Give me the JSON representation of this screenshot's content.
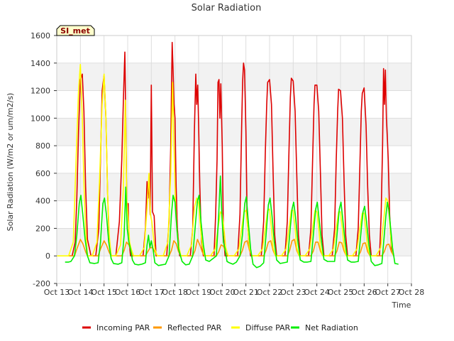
{
  "chart_data": {
    "type": "line",
    "title": "Solar Radiation",
    "xlabel": "Time",
    "ylabel": "Solar Radiation (W/m2 or um/m2/s)",
    "site_label": "SI_met",
    "xlim": [
      13,
      28
    ],
    "ylim": [
      -200,
      1600
    ],
    "x_ticks": [
      13,
      14,
      15,
      16,
      17,
      18,
      19,
      20,
      21,
      22,
      23,
      24,
      25,
      26,
      27,
      28
    ],
    "x_tick_labels": [
      "Oct 13",
      "Oct 14",
      "Oct 15",
      "Oct 16",
      "Oct 17",
      "Oct 18",
      "Oct 19",
      "Oct 20",
      "Oct 21",
      "Oct 22",
      "Oct 23",
      "Oct 24",
      "Oct 25",
      "Oct 26",
      "Oct 27",
      "Oct 28"
    ],
    "y_ticks": [
      -200,
      0,
      200,
      400,
      600,
      800,
      1000,
      1200,
      1400,
      1600
    ],
    "grid": true,
    "legend_position": "bottom",
    "series": [
      {
        "name": "Incoming PAR",
        "color": "#dd0000",
        "x": [
          13.5,
          13.65,
          13.78,
          13.85,
          13.92,
          14.0,
          14.08,
          14.15,
          14.22,
          14.3,
          14.45,
          14.5,
          14.65,
          14.78,
          14.85,
          14.92,
          15.0,
          15.08,
          15.15,
          15.22,
          15.3,
          15.45,
          15.5,
          15.65,
          15.75,
          15.82,
          15.88,
          15.92,
          15.96,
          16.02,
          16.06,
          16.12,
          16.2,
          16.45,
          16.5,
          16.65,
          16.75,
          16.82,
          16.86,
          16.9,
          16.95,
          17.0,
          17.05,
          17.12,
          17.2,
          17.45,
          17.5,
          17.65,
          17.75,
          17.82,
          17.88,
          17.92,
          17.96,
          18.0,
          18.05,
          18.1,
          18.2,
          18.3,
          18.45,
          18.5,
          18.65,
          18.75,
          18.82,
          18.88,
          18.92,
          18.96,
          19.0,
          19.05,
          19.12,
          19.2,
          19.45,
          19.5,
          19.65,
          19.72,
          19.78,
          19.82,
          19.86,
          19.9,
          19.94,
          20.0,
          20.05,
          20.12,
          20.2,
          20.45,
          20.5,
          20.65,
          20.75,
          20.82,
          20.86,
          20.9,
          20.94,
          21.0,
          21.05,
          21.12,
          21.2,
          21.3,
          21.45,
          21.5,
          21.65,
          21.75,
          21.82,
          21.88,
          21.92,
          22.0,
          22.08,
          22.15,
          22.22,
          22.3,
          22.45,
          22.5,
          22.65,
          22.75,
          22.82,
          22.88,
          22.92,
          23.0,
          23.08,
          23.15,
          23.22,
          23.3,
          23.45,
          23.5,
          23.65,
          23.75,
          23.82,
          23.88,
          23.92,
          24.0,
          24.08,
          24.15,
          24.22,
          24.3,
          24.45,
          24.5,
          24.65,
          24.75,
          24.82,
          24.88,
          24.92,
          25.0,
          25.08,
          25.15,
          25.22,
          25.3,
          25.45,
          25.5,
          25.65,
          25.75,
          25.82,
          25.88,
          25.92,
          26.0,
          26.08,
          26.15,
          26.22,
          26.3,
          26.45,
          26.5,
          26.65,
          26.72,
          26.78,
          26.82,
          26.86,
          26.9,
          26.94,
          26.98,
          27.02,
          27.08,
          27.15,
          27.25
        ],
        "values": [
          0,
          0,
          100,
          420,
          900,
          1280,
          1320,
          1050,
          500,
          120,
          0,
          0,
          0,
          200,
          700,
          1200,
          1310,
          1000,
          450,
          100,
          0,
          0,
          0,
          250,
          700,
          1140,
          1480,
          1000,
          350,
          380,
          100,
          0,
          0,
          0,
          0,
          0,
          200,
          540,
          420,
          550,
          300,
          1240,
          320,
          290,
          0,
          0,
          0,
          0,
          250,
          800,
          1550,
          1350,
          1100,
          1000,
          500,
          200,
          0,
          0,
          0,
          0,
          0,
          200,
          900,
          1320,
          1100,
          1240,
          950,
          500,
          100,
          0,
          0,
          0,
          0,
          300,
          700,
          1260,
          1280,
          1000,
          1250,
          800,
          150,
          0,
          0,
          0,
          0,
          0,
          300,
          950,
          1260,
          1400,
          1350,
          900,
          300,
          100,
          0,
          0,
          0,
          0,
          0,
          250,
          750,
          1100,
          1260,
          1280,
          1100,
          600,
          150,
          0,
          0,
          0,
          0,
          250,
          750,
          1150,
          1290,
          1270,
          1050,
          600,
          150,
          0,
          0,
          0,
          0,
          200,
          700,
          1100,
          1240,
          1240,
          1050,
          600,
          150,
          0,
          0,
          0,
          0,
          200,
          700,
          1050,
          1210,
          1200,
          1000,
          550,
          150,
          0,
          0,
          0,
          0,
          200,
          650,
          1050,
          1180,
          1220,
          950,
          500,
          150,
          0,
          0,
          0,
          0,
          300,
          800,
          1360,
          1100,
          1350,
          1000,
          860,
          700,
          300,
          50,
          0
        ]
      },
      {
        "name": "Reflected PAR",
        "color": "#ff9900",
        "x": [
          13.5,
          13.75,
          13.85,
          14.0,
          14.1,
          14.22,
          14.3,
          14.5,
          14.75,
          14.85,
          15.0,
          15.1,
          15.22,
          15.3,
          15.5,
          15.75,
          15.85,
          15.95,
          16.05,
          16.15,
          16.25,
          16.5,
          16.75,
          16.85,
          16.95,
          17.05,
          17.15,
          17.25,
          17.5,
          17.75,
          17.85,
          17.95,
          18.05,
          18.15,
          18.25,
          18.5,
          18.75,
          18.85,
          18.95,
          19.05,
          19.15,
          19.25,
          19.5,
          19.75,
          19.85,
          19.95,
          20.05,
          20.15,
          20.25,
          20.5,
          20.75,
          20.85,
          20.95,
          21.05,
          21.15,
          21.25,
          21.5,
          21.75,
          21.85,
          21.95,
          22.05,
          22.15,
          22.25,
          22.5,
          22.75,
          22.85,
          22.95,
          23.05,
          23.15,
          23.25,
          23.5,
          23.75,
          23.85,
          23.95,
          24.05,
          24.15,
          24.25,
          24.5,
          24.75,
          24.85,
          24.95,
          25.05,
          25.15,
          25.25,
          25.5,
          25.75,
          25.85,
          25.95,
          26.05,
          26.15,
          26.25,
          26.5,
          26.75,
          26.85,
          26.95,
          27.05,
          27.15,
          27.25
        ],
        "values": [
          0,
          0,
          50,
          120,
          90,
          30,
          0,
          0,
          0,
          50,
          110,
          80,
          25,
          0,
          0,
          0,
          40,
          100,
          80,
          30,
          0,
          0,
          0,
          30,
          60,
          60,
          30,
          0,
          0,
          0,
          40,
          110,
          90,
          30,
          0,
          0,
          0,
          40,
          120,
          80,
          30,
          0,
          0,
          0,
          30,
          80,
          70,
          25,
          0,
          0,
          0,
          40,
          100,
          110,
          40,
          0,
          0,
          0,
          40,
          100,
          110,
          40,
          0,
          0,
          0,
          40,
          110,
          120,
          40,
          0,
          0,
          0,
          35,
          100,
          100,
          35,
          0,
          0,
          0,
          35,
          100,
          95,
          35,
          0,
          0,
          0,
          30,
          90,
          95,
          30,
          0,
          0,
          0,
          30,
          80,
          85,
          30,
          0
        ]
      },
      {
        "name": "Diffuse PAR",
        "color": "#ffff00",
        "x": [
          13.0,
          13.5,
          13.7,
          13.82,
          13.92,
          14.0,
          14.08,
          14.15,
          14.22,
          14.3,
          14.5,
          14.7,
          14.82,
          14.92,
          15.0,
          15.08,
          15.15,
          15.22,
          15.3,
          15.5,
          15.7,
          15.82,
          15.9,
          15.96,
          16.02,
          16.08,
          16.15,
          16.25,
          16.5,
          16.7,
          16.82,
          16.9,
          16.96,
          17.02,
          17.08,
          17.15,
          17.25,
          17.5,
          17.7,
          17.82,
          17.9,
          17.96,
          18.02,
          18.08,
          18.15,
          18.25,
          18.5,
          18.7,
          18.82,
          18.92,
          19.0,
          19.08,
          19.15,
          19.25,
          19.5,
          19.7,
          19.82,
          19.92,
          20.0,
          20.08,
          20.15,
          20.25,
          20.5,
          20.7,
          20.82,
          20.92,
          21.0,
          21.08,
          21.15,
          21.25,
          21.5,
          21.7,
          21.82,
          21.92,
          22.0,
          22.08,
          22.15,
          22.25,
          22.5,
          22.7,
          22.82,
          22.92,
          23.0,
          23.08,
          23.15,
          23.25,
          23.5,
          23.7,
          23.82,
          23.92,
          24.0,
          24.08,
          24.15,
          24.25,
          24.5,
          24.7,
          24.82,
          24.92,
          25.0,
          25.08,
          25.15,
          25.25,
          25.5,
          25.7,
          25.82,
          25.92,
          26.0,
          26.08,
          26.15,
          26.25,
          26.5,
          26.7,
          26.82,
          26.92,
          27.0,
          27.08,
          27.15,
          27.25
        ],
        "values": [
          0,
          0,
          100,
          700,
          1200,
          1390,
          1000,
          530,
          200,
          0,
          0,
          100,
          600,
          1100,
          1320,
          1000,
          450,
          150,
          0,
          0,
          80,
          500,
          1130,
          400,
          280,
          100,
          50,
          0,
          0,
          60,
          350,
          600,
          300,
          250,
          150,
          50,
          0,
          0,
          100,
          600,
          1260,
          800,
          400,
          200,
          80,
          0,
          0,
          80,
          350,
          420,
          380,
          200,
          80,
          0,
          0,
          50,
          200,
          320,
          300,
          180,
          60,
          0,
          0,
          50,
          200,
          320,
          330,
          200,
          60,
          0,
          0,
          50,
          200,
          330,
          340,
          200,
          60,
          0,
          0,
          50,
          200,
          330,
          330,
          200,
          60,
          0,
          0,
          50,
          200,
          330,
          320,
          200,
          60,
          0,
          0,
          50,
          200,
          320,
          320,
          190,
          60,
          0,
          0,
          50,
          200,
          310,
          310,
          180,
          60,
          0,
          0,
          60,
          250,
          420,
          400,
          250,
          80,
          0
        ]
      },
      {
        "name": "Net Radiation",
        "color": "#00ee00",
        "x": [
          13.35,
          13.5,
          13.6,
          13.75,
          13.85,
          13.95,
          14.02,
          14.1,
          14.2,
          14.3,
          14.4,
          14.6,
          14.75,
          14.85,
          14.95,
          15.02,
          15.1,
          15.2,
          15.3,
          15.4,
          15.6,
          15.75,
          15.85,
          15.92,
          15.98,
          16.05,
          16.12,
          16.2,
          16.3,
          16.45,
          16.6,
          16.75,
          16.82,
          16.88,
          16.94,
          17.0,
          17.08,
          17.15,
          17.3,
          17.45,
          17.6,
          17.75,
          17.85,
          17.92,
          18.0,
          18.08,
          18.15,
          18.3,
          18.45,
          18.6,
          18.75,
          18.85,
          18.95,
          19.02,
          19.1,
          19.2,
          19.3,
          19.45,
          19.6,
          19.75,
          19.85,
          19.92,
          19.98,
          20.05,
          20.12,
          20.2,
          20.3,
          20.45,
          20.6,
          20.75,
          20.85,
          20.95,
          21.02,
          21.1,
          21.2,
          21.3,
          21.45,
          21.6,
          21.75,
          21.85,
          21.95,
          22.02,
          22.1,
          22.2,
          22.3,
          22.45,
          22.6,
          22.75,
          22.85,
          22.95,
          23.02,
          23.1,
          23.2,
          23.3,
          23.45,
          23.6,
          23.75,
          23.85,
          23.95,
          24.02,
          24.1,
          24.2,
          24.3,
          24.45,
          24.6,
          24.75,
          24.85,
          24.95,
          25.02,
          25.1,
          25.2,
          25.3,
          25.45,
          25.6,
          25.75,
          25.85,
          25.95,
          26.02,
          26.1,
          26.2,
          26.3,
          26.45,
          26.6,
          26.75,
          26.85,
          26.92,
          26.98,
          27.05,
          27.12,
          27.2,
          27.3,
          27.45
        ],
        "values": [
          -45,
          -45,
          -40,
          0,
          150,
          380,
          440,
          300,
          120,
          0,
          -50,
          -55,
          -50,
          100,
          380,
          420,
          300,
          100,
          -20,
          -55,
          -60,
          -50,
          150,
          500,
          200,
          100,
          50,
          -30,
          -60,
          -65,
          -60,
          -50,
          80,
          150,
          60,
          110,
          40,
          -50,
          -70,
          -65,
          -60,
          0,
          300,
          440,
          390,
          200,
          50,
          -40,
          -65,
          -60,
          0,
          200,
          400,
          440,
          250,
          80,
          -30,
          -40,
          -20,
          0,
          300,
          580,
          300,
          100,
          50,
          -40,
          -50,
          -60,
          -45,
          0,
          150,
          380,
          430,
          250,
          50,
          -60,
          -85,
          -75,
          -50,
          150,
          370,
          420,
          300,
          100,
          -30,
          -55,
          -50,
          -45,
          150,
          340,
          390,
          280,
          100,
          -30,
          -45,
          -45,
          -40,
          150,
          340,
          390,
          260,
          100,
          -25,
          -40,
          -40,
          -40,
          150,
          340,
          390,
          260,
          90,
          -30,
          -45,
          -45,
          -40,
          140,
          320,
          360,
          250,
          80,
          -40,
          -70,
          -65,
          -55,
          150,
          290,
          390,
          330,
          200,
          60,
          -55,
          -60
        ]
      }
    ]
  }
}
